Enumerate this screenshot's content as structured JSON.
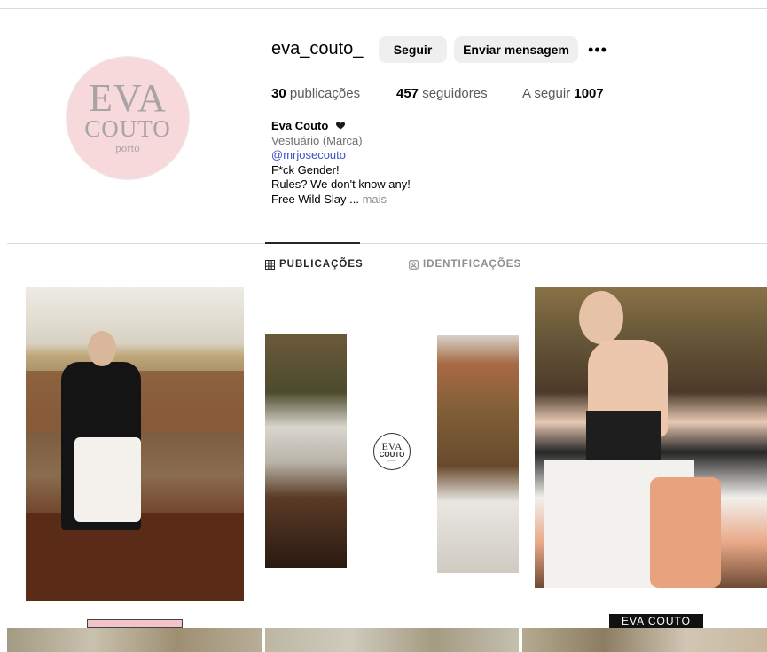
{
  "profile": {
    "username": "eva_couto_",
    "avatar_lines": [
      "EVA",
      "COUTO",
      "porto"
    ],
    "follow_label": "Seguir",
    "message_label": "Enviar mensagem",
    "more_label": "•••"
  },
  "stats": {
    "posts_count": "30",
    "posts_label": "publicações",
    "followers_count": "457",
    "followers_label": "seguidores",
    "following_label": "A seguir",
    "following_count": "1007"
  },
  "bio": {
    "name": "Eva Couto",
    "category": "Vestuário (Marca)",
    "mention": "@mrjosecouto",
    "line1": "F*ck Gender!",
    "line2": "Rules? We don't know any!",
    "line3": "Free Wild Slay ...",
    "more": "mais"
  },
  "tabs": {
    "posts": "PUBLICAÇÕES",
    "tagged": "IDENTIFICAÇÕES"
  },
  "posts": {
    "center_logo": [
      "EVA",
      "COUTO",
      "porto"
    ],
    "label_peek": "EVA COUTO"
  },
  "colors": {
    "accent_link": "#3a50c6",
    "avatar_bg": "#f7d9dc"
  }
}
